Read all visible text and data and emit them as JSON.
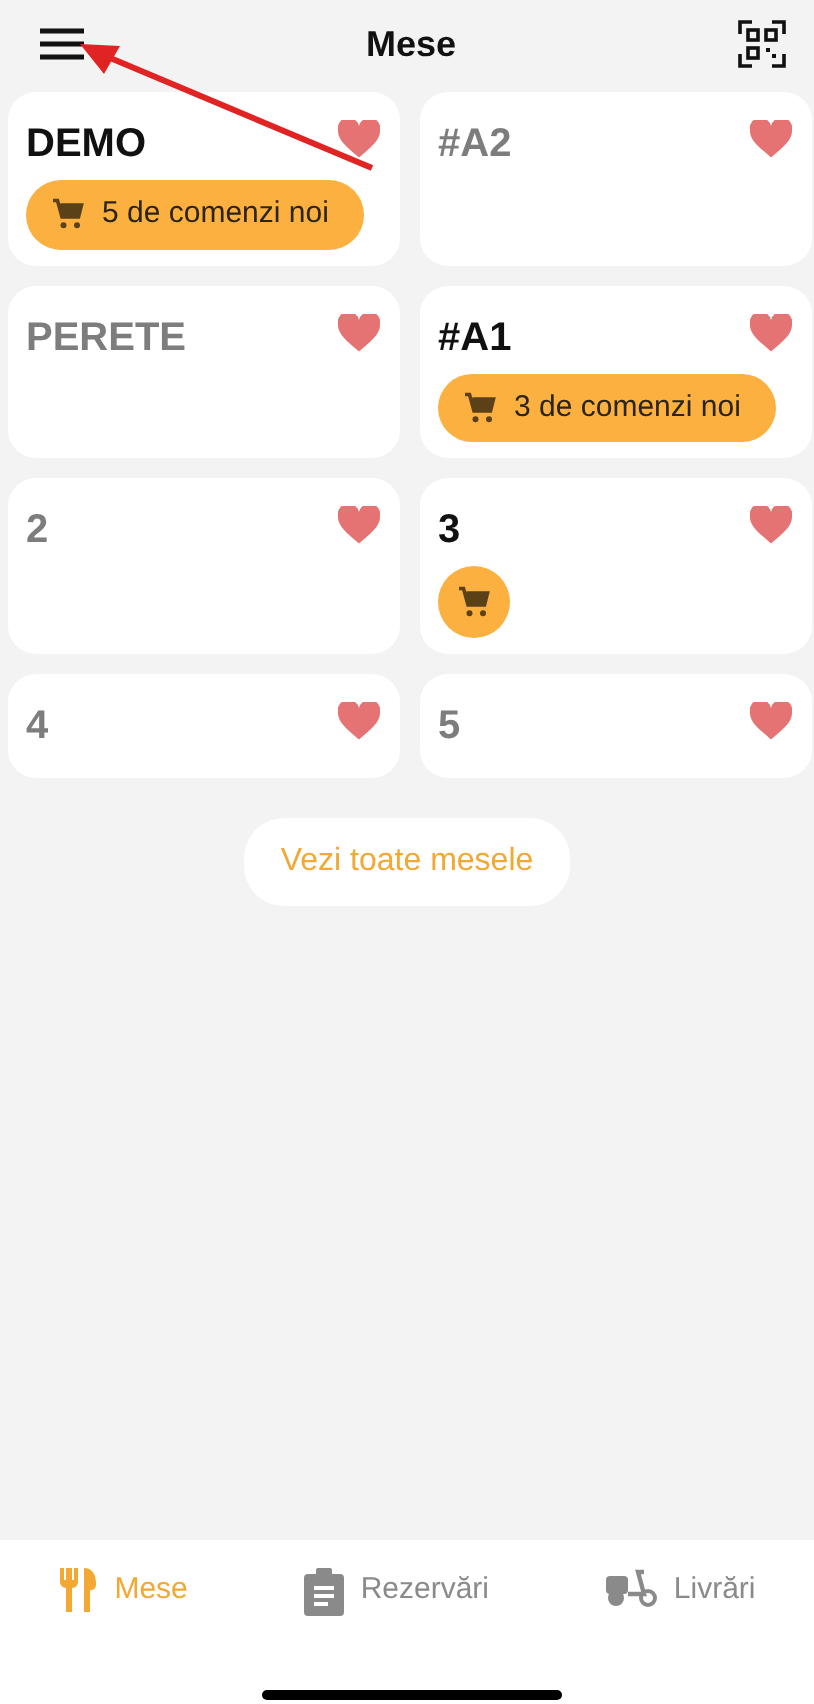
{
  "header": {
    "title": "Mese"
  },
  "tables": [
    {
      "name": "DEMO",
      "active": true,
      "kind": "orders",
      "orders": "5 de comenzi noi"
    },
    {
      "name": "#A2",
      "active": false,
      "kind": "none"
    },
    {
      "name": "PERETE",
      "active": false,
      "kind": "none"
    },
    {
      "name": "#A1",
      "active": true,
      "kind": "orders",
      "orders": "3 de comenzi noi"
    },
    {
      "name": "2",
      "active": false,
      "kind": "none"
    },
    {
      "name": "3",
      "active": true,
      "kind": "cart"
    },
    {
      "name": "4",
      "active": false,
      "kind": "none"
    },
    {
      "name": "5",
      "active": false,
      "kind": "none"
    }
  ],
  "show_all_button": "Vezi toate mesele",
  "tabs": [
    {
      "label": "Mese",
      "kind": "tables",
      "selected": true
    },
    {
      "label": "Rezervări",
      "kind": "reservations",
      "selected": false
    },
    {
      "label": "Livrări",
      "kind": "delivery",
      "selected": false
    }
  ]
}
